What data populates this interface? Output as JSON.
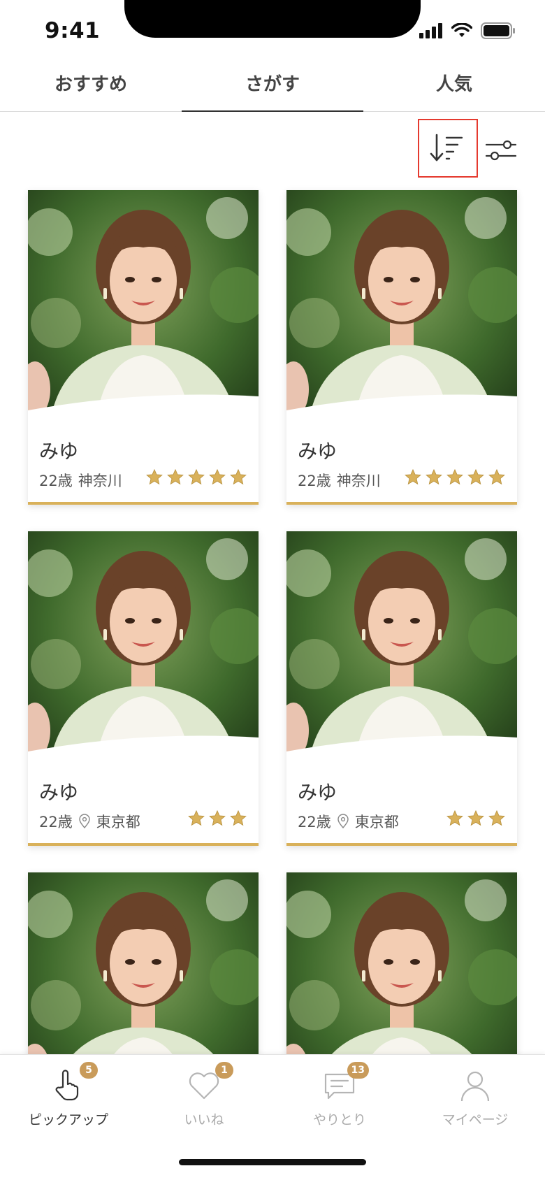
{
  "status_bar": {
    "time": "9:41"
  },
  "tabs": [
    {
      "label": "おすすめ",
      "active": false
    },
    {
      "label": "さがす",
      "active": true
    },
    {
      "label": "人気",
      "active": false
    }
  ],
  "toolbar": {
    "sort_icon": "sort-descending-icon",
    "filter_icon": "sliders-icon"
  },
  "cards": [
    {
      "name": "みゆ",
      "age": "22歳",
      "location": "神奈川",
      "show_pin": false,
      "stars": 5
    },
    {
      "name": "みゆ",
      "age": "22歳",
      "location": "神奈川",
      "show_pin": false,
      "stars": 5
    },
    {
      "name": "みゆ",
      "age": "22歳",
      "location": "東京都",
      "show_pin": true,
      "stars": 3
    },
    {
      "name": "みゆ",
      "age": "22歳",
      "location": "東京都",
      "show_pin": true,
      "stars": 3
    },
    {
      "name": "",
      "age": "",
      "location": "",
      "show_pin": false,
      "stars": 0
    },
    {
      "name": "",
      "age": "",
      "location": "",
      "show_pin": false,
      "stars": 0
    }
  ],
  "bottom_nav": [
    {
      "label": "ピックアップ",
      "badge": "5",
      "icon": "hand-pointer-icon",
      "active": true
    },
    {
      "label": "いいね",
      "badge": "1",
      "icon": "heart-icon",
      "active": false
    },
    {
      "label": "やりとり",
      "badge": "13",
      "icon": "chat-icon",
      "active": false
    },
    {
      "label": "マイページ",
      "badge": "",
      "icon": "person-icon",
      "active": false
    }
  ],
  "colors": {
    "gold": "#d9b15a",
    "badge": "#c99b5a",
    "highlight": "#e53a2f"
  }
}
